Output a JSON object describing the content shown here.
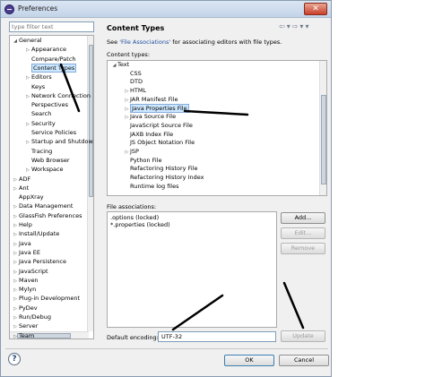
{
  "window": {
    "title": "Preferences",
    "close_glyph": "✕"
  },
  "filter": {
    "placeholder": "type filter text"
  },
  "tree": {
    "items": [
      {
        "label": "General",
        "depth": 0,
        "expanded": true
      },
      {
        "label": "Appearance",
        "depth": 1,
        "expandable": true
      },
      {
        "label": "Compare/Patch",
        "depth": 1
      },
      {
        "label": "Content Types",
        "depth": 1,
        "selected": true
      },
      {
        "label": "Editors",
        "depth": 1,
        "expandable": true
      },
      {
        "label": "Keys",
        "depth": 1
      },
      {
        "label": "Network Connection",
        "depth": 1,
        "expandable": true
      },
      {
        "label": "Perspectives",
        "depth": 1
      },
      {
        "label": "Search",
        "depth": 1
      },
      {
        "label": "Security",
        "depth": 1,
        "expandable": true
      },
      {
        "label": "Service Policies",
        "depth": 1
      },
      {
        "label": "Startup and Shutdown",
        "depth": 1,
        "expandable": true
      },
      {
        "label": "Tracing",
        "depth": 1
      },
      {
        "label": "Web Browser",
        "depth": 1
      },
      {
        "label": "Workspace",
        "depth": 1,
        "expandable": true
      },
      {
        "label": "ADF",
        "depth": 0,
        "expandable": true
      },
      {
        "label": "Ant",
        "depth": 0,
        "expandable": true
      },
      {
        "label": "AppXray",
        "depth": 0
      },
      {
        "label": "Data Management",
        "depth": 0,
        "expandable": true
      },
      {
        "label": "GlassFish Preferences",
        "depth": 0,
        "expandable": true
      },
      {
        "label": "Help",
        "depth": 0,
        "expandable": true
      },
      {
        "label": "Install/Update",
        "depth": 0,
        "expandable": true
      },
      {
        "label": "Java",
        "depth": 0,
        "expandable": true
      },
      {
        "label": "Java EE",
        "depth": 0,
        "expandable": true
      },
      {
        "label": "Java Persistence",
        "depth": 0,
        "expandable": true
      },
      {
        "label": "JavaScript",
        "depth": 0,
        "expandable": true
      },
      {
        "label": "Maven",
        "depth": 0,
        "expandable": true
      },
      {
        "label": "Mylyn",
        "depth": 0,
        "expandable": true
      },
      {
        "label": "Plug-in Development",
        "depth": 0,
        "expandable": true
      },
      {
        "label": "PyDev",
        "depth": 0,
        "expandable": true
      },
      {
        "label": "Run/Debug",
        "depth": 0,
        "expandable": true
      },
      {
        "label": "Server",
        "depth": 0,
        "expandable": true
      },
      {
        "label": "Team",
        "depth": 0,
        "expandable": true
      }
    ]
  },
  "pane": {
    "title": "Content Types",
    "see_prefix": "See ",
    "see_link": "'File Associations'",
    "see_suffix": " for associating editors with file types.",
    "content_types_label": "Content types:",
    "content_types": [
      {
        "label": "Text",
        "depth": 0,
        "expanded": true
      },
      {
        "label": "CSS",
        "depth": 1
      },
      {
        "label": "DTD",
        "depth": 1
      },
      {
        "label": "HTML",
        "depth": 1,
        "expandable": true
      },
      {
        "label": "JAR Manifest File",
        "depth": 1,
        "expandable": true
      },
      {
        "label": "Java Properties File",
        "depth": 1,
        "expandable": true,
        "selected": true
      },
      {
        "label": "Java Source File",
        "depth": 1,
        "expandable": true
      },
      {
        "label": "JavaScript Source File",
        "depth": 1
      },
      {
        "label": "JAXB Index File",
        "depth": 1
      },
      {
        "label": "JS Object Notation File",
        "depth": 1
      },
      {
        "label": "JSP",
        "depth": 1,
        "expandable": true
      },
      {
        "label": "Python File",
        "depth": 1
      },
      {
        "label": "Refactoring History File",
        "depth": 1
      },
      {
        "label": "Refactoring History Index",
        "depth": 1
      },
      {
        "label": "Runtime log files",
        "depth": 1
      }
    ],
    "file_assoc_label": "File associations:",
    "file_associations": [
      ".options (locked)",
      "*.properties (locked)"
    ],
    "buttons": {
      "add": "Add...",
      "edit": "Edit...",
      "remove": "Remove",
      "update": "Update"
    },
    "encoding_label": "Default encoding:",
    "encoding_value": "UTF-32"
  },
  "footer": {
    "help": "?",
    "ok": "OK",
    "cancel": "Cancel"
  },
  "colors": {
    "selection": "#cde8ff",
    "link": "#1f4fa0"
  }
}
